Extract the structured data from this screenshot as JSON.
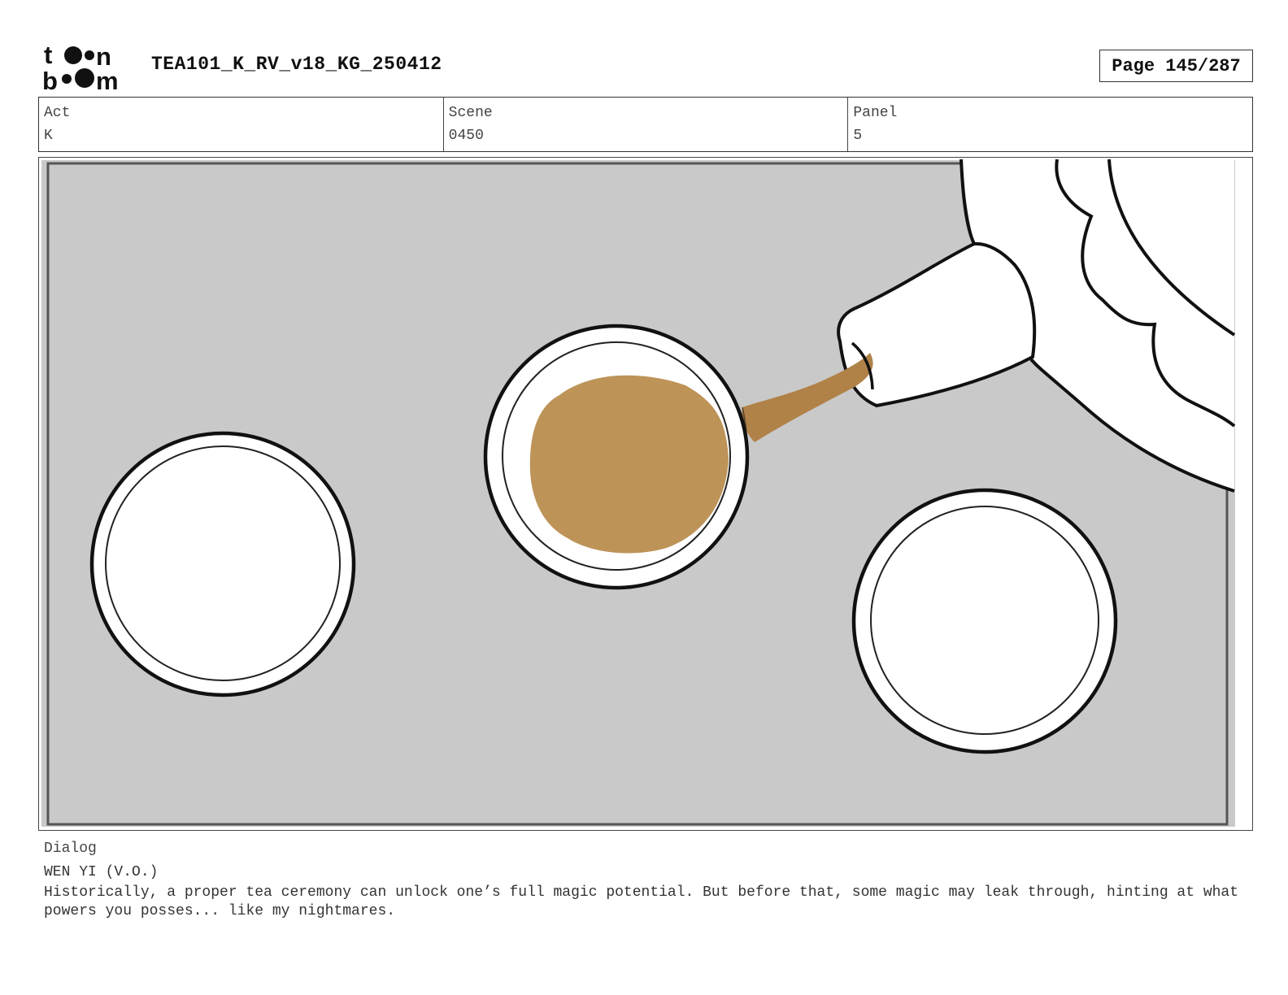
{
  "header": {
    "logo_icon": "toonboom-logo-icon",
    "logo_text": "toon boom",
    "title": "TEA101_K_RV_v18_KG_250412",
    "page_label": "Page 145/287"
  },
  "info": {
    "act_label": "Act",
    "act_value": "K",
    "scene_label": "Scene",
    "scene_value": "0450",
    "panel_label": "Panel",
    "panel_value": "5"
  },
  "panel": {
    "background_color": "#c9c9c9",
    "tea_color": "#bd9358",
    "stream_color": "#b08248"
  },
  "dialog": {
    "label": "Dialog",
    "speaker": "WEN YI (V.O.)",
    "text": "Historically, a proper tea ceremony can unlock one’s full magic potential. But before that, some magic may leak through, hinting at what powers you posses... like my nightmares."
  }
}
